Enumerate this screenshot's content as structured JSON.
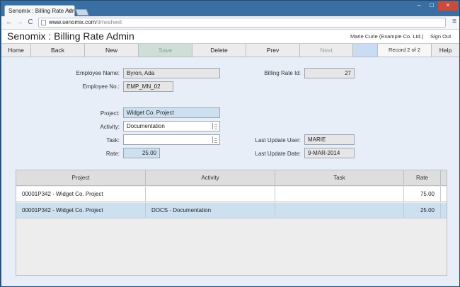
{
  "browser": {
    "tab_title": "Senomix : Billing Rate Adm",
    "tab_close": "×",
    "url_host": "www.senomix.com",
    "url_path": "/timesheet",
    "back_glyph": "←",
    "forward_glyph": "→",
    "reload_glyph": "C",
    "menu_glyph": "≡",
    "window_controls": [
      "–",
      "□",
      "×"
    ]
  },
  "header": {
    "title": "Senomix : Billing Rate Admin",
    "user": "Marie Curie  (Example Co. Ltd.)",
    "sign_out": "Sign Out"
  },
  "actions": {
    "home": "Home",
    "back": "Back",
    "new": "New",
    "save": "Save",
    "delete": "Delete",
    "prev": "Prev",
    "next": "Next",
    "record": "Record 2 of 2",
    "help": "Help"
  },
  "form": {
    "employee_name_label": "Employee Name:",
    "employee_name": "Byron, Ada",
    "employee_no_label": "Employee No.:",
    "employee_no": "EMP_MN_02",
    "billing_rate_id_label": "Billing Rate Id:",
    "billing_rate_id": "27",
    "project_label": "Project:",
    "project": "Widget Co. Project",
    "activity_label": "Activity:",
    "activity": "Documentation",
    "task_label": "Task:",
    "task": "",
    "rate_label": "Rate:",
    "rate": "25.00",
    "last_update_user_label": "Last Update User:",
    "last_update_user": "MARIE",
    "last_update_date_label": "Last Update Date:",
    "last_update_date": "9-MAR-2014"
  },
  "grid": {
    "columns": [
      "Project",
      "Activity",
      "Task",
      "Rate"
    ],
    "rows": [
      {
        "project": "00001P342 - Widget Co. Project",
        "activity": "",
        "task": "",
        "rate": "75.00"
      },
      {
        "project": "00001P342 - Widget Co. Project",
        "activity": "DOCS - Documentation",
        "task": "",
        "rate": "25.00"
      }
    ]
  },
  "colors": {
    "accent_blue": "#cde0f0",
    "selected_row": "#cce0f0",
    "disabled_button": "#cfded6"
  }
}
